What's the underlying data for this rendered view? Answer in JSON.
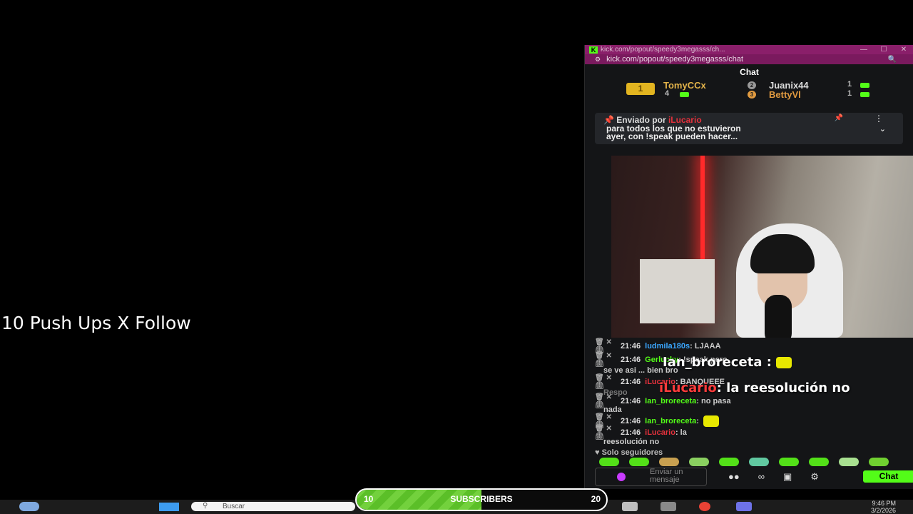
{
  "overlay": {
    "text": "10 Push Ups X Follow"
  },
  "browser": {
    "tab_url": "kick.com/popout/speedy3megasss/ch...",
    "address": "kick.com/popout/speedy3megasss/chat",
    "controls": [
      "—",
      "☐",
      "✕"
    ]
  },
  "chat": {
    "title": "Chat",
    "leaderboard": [
      {
        "rank": "1",
        "name": "TomyCCx",
        "count": "4"
      },
      {
        "rank": "2",
        "name": "Juanix44",
        "count": "1"
      },
      {
        "rank": "3",
        "name": "BettyVl",
        "count": "1"
      }
    ],
    "pinned": {
      "sent_by_label": "Enviado por",
      "user": "iLucario",
      "text_line1": "para todos los que no estuvieron",
      "text_line2": "ayer, con !speak pueden hacer..."
    },
    "messages": [
      {
        "time": "21:46",
        "user": "ludmila180s",
        "color": "#3ba7ff",
        "text": ": LJAAA"
      },
      {
        "time": "21:46",
        "user": "Gerlucky",
        "color": "#53fc18",
        "text": ": !speak pero"
      },
      {
        "time": "21:46",
        "user": "iLucario",
        "color": "#e5313c",
        "text": ": BANQUEEE"
      },
      {
        "time": "21:46",
        "user": "Ian_broreceta",
        "color": "#53fc18",
        "text": ": no pasa"
      },
      {
        "time": "21:46",
        "user": "Ian_broreceta",
        "color": "#53fc18",
        "text": ":"
      },
      {
        "time": "21:46",
        "user": "iLucario",
        "color": "#e5313c",
        "text": ": la"
      }
    ],
    "continuations": {
      "m2": "se ve asi",
      "m2b": "bien bro",
      "m4": "nada",
      "m6": "reesolución no",
      "reply": "Respo"
    },
    "tts_overlay": {
      "line1_user": "Ian_broreceta",
      "line1_sep": ":",
      "line2_user": "iLucario",
      "line2_text": ": la reesolución no"
    },
    "followers_only": "Solo seguidores",
    "input_placeholder": "Enviar un mensaje",
    "send_button": "Chat"
  },
  "taskbar": {
    "search_placeholder": "Buscar",
    "time": "9:46 PM",
    "date": "3/2/2026"
  },
  "goal": {
    "label": "SUBSCRIBERS",
    "current": "10",
    "target": "20",
    "progress": 0.5
  }
}
